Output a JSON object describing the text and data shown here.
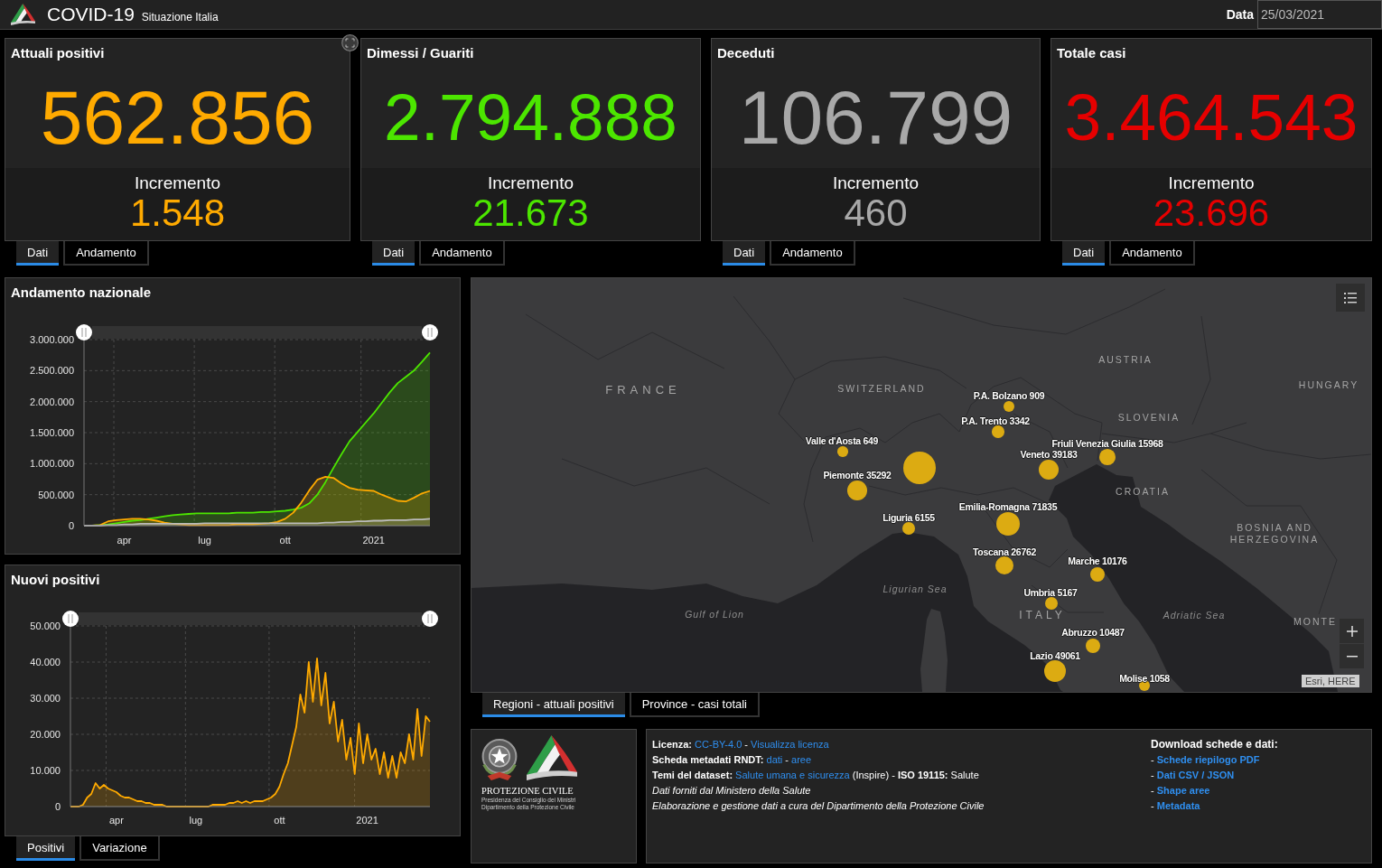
{
  "header": {
    "title": "COVID-19",
    "subtitle": "Situazione Italia",
    "date_label": "Data",
    "date_value": "25/03/2021"
  },
  "cards": [
    {
      "title": "Attuali positivi",
      "value": "562.856",
      "increment_label": "Incremento",
      "increment": "1.548",
      "color": "#ffaa00",
      "tabs": [
        {
          "label": "Dati",
          "selected": true
        },
        {
          "label": "Andamento",
          "selected": false
        }
      ]
    },
    {
      "title": "Dimessi / Guariti",
      "value": "2.794.888",
      "increment_label": "Incremento",
      "increment": "21.673",
      "color": "#4ce600",
      "tabs": [
        {
          "label": "Dati",
          "selected": true
        },
        {
          "label": "Andamento",
          "selected": false
        }
      ]
    },
    {
      "title": "Deceduti",
      "value": "106.799",
      "increment_label": "Incremento",
      "increment": "460",
      "color": "#a8a8a8",
      "tabs": [
        {
          "label": "Dati",
          "selected": true
        },
        {
          "label": "Andamento",
          "selected": false
        }
      ]
    },
    {
      "title": "Totale casi",
      "value": "3.464.543",
      "increment_label": "Incremento",
      "increment": "23.696",
      "color": "#e60000",
      "tabs": [
        {
          "label": "Dati",
          "selected": true
        },
        {
          "label": "Andamento",
          "selected": false
        }
      ]
    }
  ],
  "national_panel": {
    "title": "Andamento nazionale",
    "chart_data": {
      "type": "area",
      "grid": true,
      "categories": [
        null,
        null,
        null,
        null,
        null,
        "apr",
        null,
        null,
        null,
        null,
        null,
        null,
        null,
        null,
        null,
        "lug",
        null,
        null,
        null,
        null,
        null,
        null,
        null,
        null,
        null,
        "ott",
        null,
        null,
        null,
        null,
        null,
        null,
        null,
        null,
        null,
        null,
        "2021",
        null,
        null,
        null,
        null,
        null,
        null,
        null
      ],
      "series": [
        {
          "color": "#4ce600",
          "values": [
            0,
            0,
            10000,
            20000,
            40000,
            60000,
            80000,
            90000,
            110000,
            130000,
            150000,
            170000,
            180000,
            190000,
            200000,
            200000,
            200000,
            200000,
            200000,
            210000,
            210000,
            210000,
            220000,
            220000,
            230000,
            240000,
            260000,
            290000,
            360000,
            500000,
            700000,
            930000,
            1150000,
            1360000,
            1510000,
            1660000,
            1810000,
            1980000,
            2150000,
            2300000,
            2400000,
            2500000,
            2640000,
            2790000
          ]
        },
        {
          "color": "#ffaa00",
          "values": [
            0,
            0,
            10000,
            70000,
            90000,
            100000,
            110000,
            110000,
            100000,
            80000,
            50000,
            30000,
            20000,
            10000,
            10000,
            10000,
            10000,
            10000,
            10000,
            20000,
            20000,
            20000,
            30000,
            40000,
            60000,
            110000,
            210000,
            370000,
            570000,
            740000,
            790000,
            770000,
            680000,
            610000,
            580000,
            570000,
            560000,
            500000,
            450000,
            400000,
            390000,
            450000,
            520000,
            560000
          ]
        },
        {
          "color": "#bbbbbb",
          "values": [
            0,
            0,
            0,
            10000,
            10000,
            20000,
            20000,
            30000,
            30000,
            30000,
            30000,
            30000,
            30000,
            30000,
            30000,
            40000,
            40000,
            40000,
            40000,
            40000,
            40000,
            40000,
            40000,
            40000,
            40000,
            40000,
            40000,
            40000,
            40000,
            40000,
            50000,
            50000,
            60000,
            60000,
            70000,
            70000,
            80000,
            80000,
            90000,
            90000,
            90000,
            100000,
            100000,
            110000
          ]
        }
      ],
      "ylim": [
        0,
        3000000
      ],
      "yticks": [
        {
          "value": 0,
          "label": "0"
        },
        {
          "value": 500000,
          "label": "500.000"
        },
        {
          "value": 1000000,
          "label": "1.000.000"
        },
        {
          "value": 1500000,
          "label": "1.500.000"
        },
        {
          "value": 2000000,
          "label": "2.000.000"
        },
        {
          "value": 2500000,
          "label": "2.500.000"
        },
        {
          "value": 3000000,
          "label": "3.000.000"
        }
      ]
    }
  },
  "new_cases_panel": {
    "title": "Nuovi positivi",
    "chart_data": {
      "type": "area",
      "grid": true,
      "categories": [
        null,
        null,
        null,
        null,
        null,
        null,
        null,
        null,
        null,
        null,
        null,
        "apr",
        null,
        null,
        null,
        null,
        null,
        null,
        null,
        null,
        null,
        null,
        null,
        null,
        null,
        null,
        null,
        null,
        null,
        null,
        "lug",
        null,
        null,
        null,
        null,
        null,
        null,
        null,
        null,
        null,
        null,
        null,
        null,
        null,
        null,
        null,
        null,
        null,
        null,
        null,
        "ott",
        null,
        null,
        null,
        null,
        null,
        null,
        null,
        null,
        null,
        null,
        null,
        null,
        null,
        null,
        null,
        null,
        null,
        null,
        null,
        null,
        "2021",
        null,
        null,
        null,
        null,
        null,
        null,
        null,
        null,
        null,
        null,
        null,
        null,
        null,
        null,
        null
      ],
      "series": [
        {
          "color": "#ffaa00",
          "values": [
            0,
            0,
            0,
            500,
            2500,
            3500,
            6500,
            5000,
            6000,
            5000,
            4500,
            4000,
            3000,
            2500,
            2500,
            2000,
            1500,
            1500,
            1000,
            1000,
            500,
            500,
            500,
            0,
            0,
            0,
            0,
            0,
            0,
            0,
            0,
            0,
            0,
            0,
            500,
            500,
            500,
            500,
            1000,
            1000,
            1500,
            1000,
            1500,
            1000,
            1500,
            1500,
            1500,
            2000,
            2500,
            3500,
            5500,
            9000,
            12000,
            17000,
            22000,
            31000,
            26000,
            40000,
            29000,
            41000,
            28000,
            37000,
            23000,
            29000,
            18000,
            24000,
            13000,
            19000,
            9000,
            23000,
            12000,
            20000,
            13000,
            16000,
            9000,
            15000,
            8000,
            14000,
            8000,
            15000,
            12000,
            20000,
            13000,
            27000,
            14000,
            25000,
            23500
          ]
        }
      ],
      "ylim": [
        0,
        50000
      ],
      "yticks": [
        {
          "value": 0,
          "label": "0"
        },
        {
          "value": 10000,
          "label": "10.000"
        },
        {
          "value": 20000,
          "label": "20.000"
        },
        {
          "value": 30000,
          "label": "30.000"
        },
        {
          "value": 40000,
          "label": "40.000"
        },
        {
          "value": 50000,
          "label": "50.000"
        }
      ]
    },
    "tabs": [
      {
        "label": "Positivi",
        "selected": true
      },
      {
        "label": "Variazione",
        "selected": false
      }
    ]
  },
  "map": {
    "places": [
      {
        "kind": "country",
        "text": "FRANCE"
      },
      {
        "kind": "country",
        "text": "SWITZERLAND"
      },
      {
        "kind": "country",
        "text": "AUSTRIA"
      },
      {
        "kind": "country",
        "text": "HUNGARY"
      },
      {
        "kind": "country",
        "text": "SLOVENIA"
      },
      {
        "kind": "country",
        "text": "CROATIA"
      },
      {
        "kind": "country",
        "text": "BOSNIA AND HERZEGOVINA"
      },
      {
        "kind": "sea",
        "text": "Ligurian Sea"
      },
      {
        "kind": "sea",
        "text": "Gulf of Lion"
      },
      {
        "kind": "country",
        "text": "ITALY"
      },
      {
        "kind": "sea",
        "text": "Adriatic Sea"
      },
      {
        "kind": "country",
        "text": "MONTE"
      }
    ],
    "markers": [
      {
        "kind": "labeled",
        "name": "P.A. Bolzano",
        "value": "909"
      },
      {
        "kind": "labeled",
        "name": "P.A. Trento",
        "value": "3342"
      },
      {
        "kind": "labeled",
        "name": "Valle d'Aosta",
        "value": "649"
      },
      {
        "kind": "labeled",
        "name": "Piemonte",
        "value": "35292"
      },
      {
        "kind": "labeled",
        "name": "Veneto",
        "value": "39183"
      },
      {
        "kind": "labeled",
        "name": "Friuli Venezia Giulia",
        "value": "15968"
      },
      {
        "kind": "labeled",
        "name": "Emilia-Romagna",
        "value": "71835"
      },
      {
        "kind": "labeled",
        "name": "Liguria",
        "value": "6155"
      },
      {
        "kind": "labeled",
        "name": "Toscana",
        "value": "26762"
      },
      {
        "kind": "labeled",
        "name": "Marche",
        "value": "10176"
      },
      {
        "kind": "labeled",
        "name": "Umbria",
        "value": "5167"
      },
      {
        "kind": "labeled",
        "name": "Abruzzo",
        "value": "10487"
      },
      {
        "kind": "labeled",
        "name": "Lazio",
        "value": "49061"
      },
      {
        "kind": "labeled",
        "name": "Molise",
        "value": "1058"
      },
      {
        "kind": "unlabeled"
      }
    ],
    "attribution": "Esri, HERE",
    "tabs": [
      {
        "label": "Regioni - attuali positivi",
        "selected": true
      },
      {
        "label": "Province - casi totali",
        "selected": false
      }
    ]
  },
  "logo_panel": {
    "name": "PROTEZIONE CIVILE",
    "lines": [
      "Presidenza del Consiglio dei Ministri",
      "Dipartimento della Protezione Civile"
    ]
  },
  "info_panel": {
    "lines": [
      [
        {
          "kind": "bold",
          "text": "Licenza:"
        },
        {
          "kind": "link",
          "text": "CC-BY-4.0"
        },
        {
          "kind": "plain",
          "text": "-"
        },
        {
          "kind": "link",
          "text": "Visualizza licenza"
        }
      ],
      [
        {
          "kind": "bold",
          "text": "Scheda metadati RNDT:"
        },
        {
          "kind": "link",
          "text": "dati"
        },
        {
          "kind": "plain",
          "text": "-"
        },
        {
          "kind": "link",
          "text": "aree"
        }
      ],
      [
        {
          "kind": "bold",
          "text": "Temi del dataset:"
        },
        {
          "kind": "link",
          "text": "Salute umana e sicurezza"
        },
        {
          "kind": "plain",
          "text": "(Inspire) -"
        },
        {
          "kind": "bold",
          "text": "ISO 19115:"
        },
        {
          "kind": "plain",
          "text": "Salute"
        }
      ],
      [
        {
          "kind": "italic",
          "text": "Dati forniti dal Ministero della Salute"
        }
      ],
      [
        {
          "kind": "italic",
          "text": "Elaborazione e gestione dati a cura del Dipartimento della Protezione Civile"
        }
      ]
    ],
    "download": {
      "title": "Download schede e dati:",
      "items": [
        {
          "prefix": "-",
          "link": "Schede riepilogo PDF"
        },
        {
          "prefix": "-",
          "link": "Dati CSV / JSON"
        },
        {
          "prefix": "-",
          "link": "Shape aree"
        },
        {
          "prefix": "-",
          "link": "Metadata"
        }
      ]
    }
  }
}
